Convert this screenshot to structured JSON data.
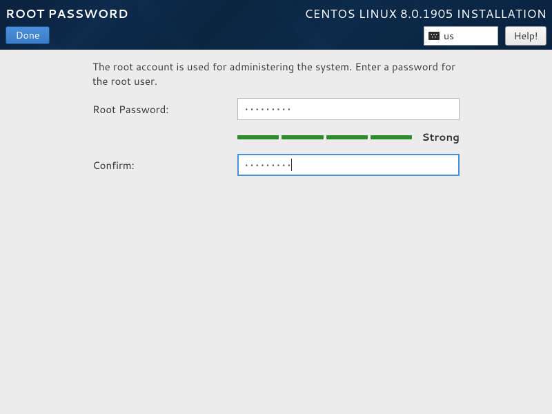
{
  "header": {
    "page_title": "ROOT PASSWORD",
    "install_title": "CENTOS LINUX 8.0.1905 INSTALLATION",
    "done_label": "Done",
    "help_label": "Help!",
    "keyboard_layout": "us"
  },
  "form": {
    "description": "The root account is used for administering the system.  Enter a password for the root user.",
    "root_password_label": "Root Password:",
    "root_password_value": "•••••••••",
    "confirm_label": "Confirm:",
    "confirm_value": "•••••••••",
    "strength_label": "Strong"
  },
  "colors": {
    "accent": "#4a90d9",
    "strength_fill": "#2d8a2d"
  }
}
